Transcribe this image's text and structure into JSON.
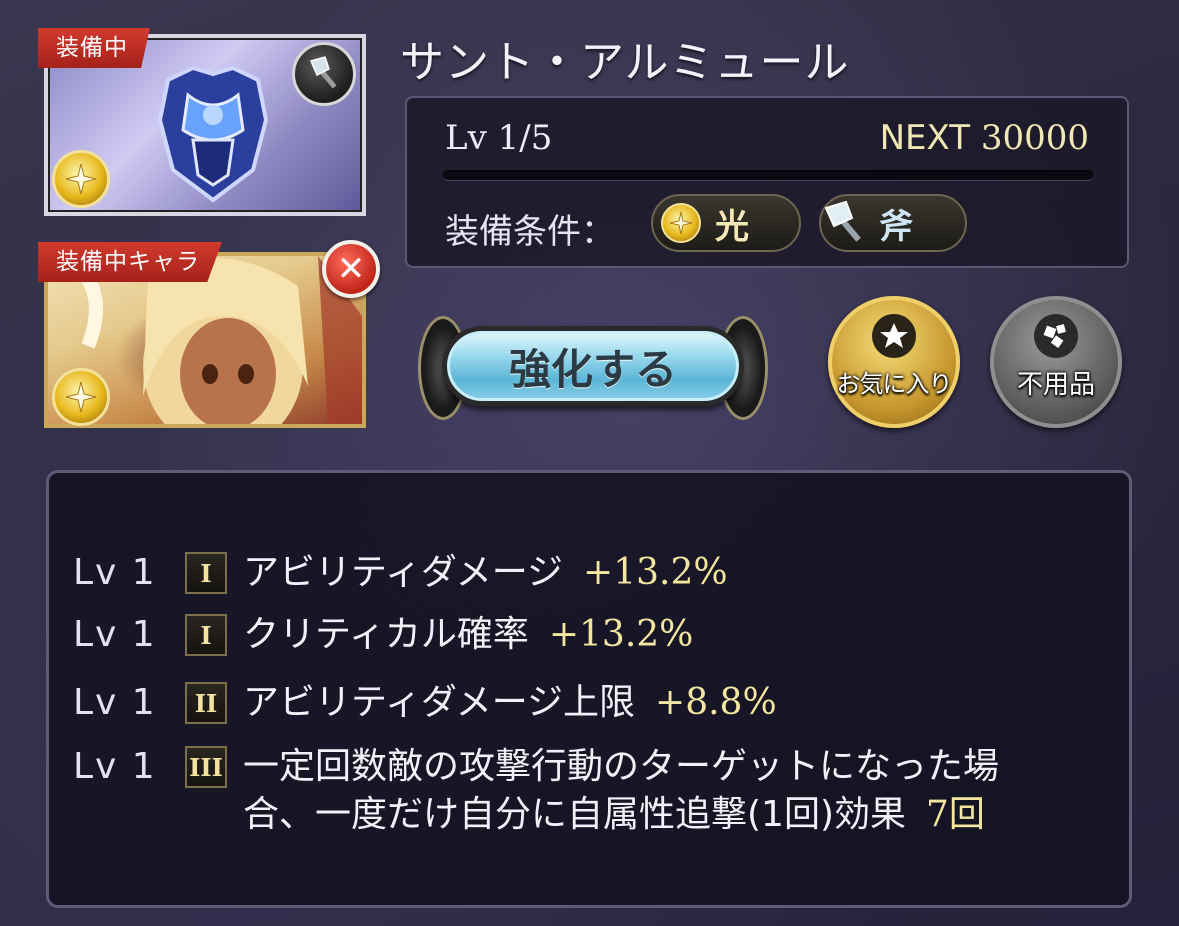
{
  "item": {
    "name": "サント・アルミュール",
    "equipped_tag": "装備中",
    "weapon_type_icon": "axe-icon",
    "element_icon": "light-element-icon"
  },
  "character": {
    "equipped_chara_tag": "装備中キャラ",
    "remove_icon": "close-icon"
  },
  "level": {
    "label": "Lv",
    "value": "1/5",
    "next_label": "NEXT",
    "next_value": "30000",
    "progress": 0.0
  },
  "conditions": {
    "label": "装備条件：",
    "element": "光",
    "weapon": "斧"
  },
  "actions": {
    "enhance": "強化する",
    "favorite": "お気に入り",
    "unused": "不用品"
  },
  "skills": [
    {
      "lv": "Lv 1",
      "rank": "I",
      "text": "アビリティダメージ",
      "value": "+13.2%"
    },
    {
      "lv": "Lv 1",
      "rank": "I",
      "text": "クリティカル確率",
      "value": "+13.2%"
    },
    {
      "lv": "Lv 1",
      "rank": "II",
      "text": "アビリティダメージ上限",
      "value": "+8.8%"
    },
    {
      "lv": "Lv 1",
      "rank": "III",
      "text": "一定回数敵の攻撃行動のターゲットになった場",
      "text2": "合、一度だけ自分に自属性追撃(1回)効果",
      "value": "7回"
    }
  ],
  "colors": {
    "tag_red": "#c22f24",
    "gold_text": "#f2e6a0",
    "panel_border": "#5e5b78"
  }
}
